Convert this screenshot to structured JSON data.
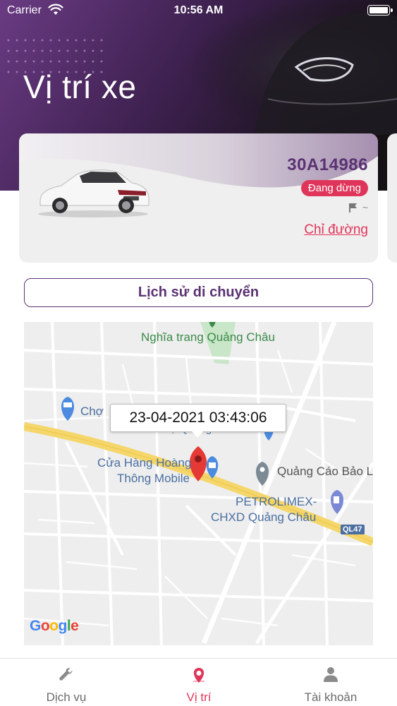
{
  "status_bar": {
    "carrier": "Carrier",
    "time": "10:56 AM"
  },
  "page": {
    "title": "Vị trí xe"
  },
  "vehicle": {
    "plate": "30A14986",
    "status": "Đang dừng",
    "flag_value": "~",
    "directions_label": "Chỉ đường"
  },
  "history_button": {
    "label": "Lịch sử di chuyển"
  },
  "map": {
    "callout_time": "23-04-2021 03:43:06",
    "places": {
      "cemetery": "Nghĩa trang Quảng Châu",
      "market_left": "Chợ",
      "market_under": "Chợ Quảng Châu",
      "shop_line1": "Cửa Hàng Hoàng",
      "shop_line2": "Thông Mobile",
      "ad": "Quảng Cáo Bảo L",
      "petro_line1": "PETROLIMEX-",
      "petro_line2": "CHXD Quảng Châu"
    },
    "road_badge": "QL47",
    "logo": "Google"
  },
  "tabbar": {
    "items": [
      {
        "label": "Dịch vụ",
        "icon": "wrench-icon"
      },
      {
        "label": "Vị trí",
        "icon": "location-pin-icon"
      },
      {
        "label": "Tài khoản",
        "icon": "person-icon"
      }
    ],
    "active_color": "#e0355a",
    "inactive_color": "#6b6b6b"
  },
  "colors": {
    "brand_purple": "#5b3272",
    "accent_pink": "#e0355a",
    "header_dark": "#2a1430"
  }
}
